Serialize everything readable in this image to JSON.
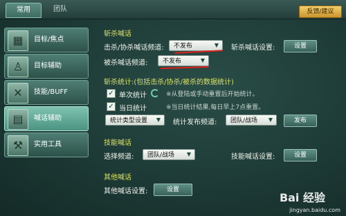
{
  "tabs": [
    {
      "label": "常用"
    },
    {
      "label": "团队"
    }
  ],
  "feedback_label": "反馈/建议",
  "sidebar": {
    "items": [
      {
        "label": "目标/焦点"
      },
      {
        "label": "目标辅助"
      },
      {
        "label": "技能/BUFF"
      },
      {
        "label": "喊话辅助"
      },
      {
        "label": "实用工具"
      }
    ]
  },
  "kill_shout": {
    "title": "斩杀喊话",
    "kill_channel_label": "击杀/协杀喊话频道:",
    "kill_channel_value": "不发布",
    "kill_settings_label": "斩杀喊话设置:",
    "killed_channel_label": "被杀喊话频道:",
    "killed_channel_value": "不发布",
    "settings_button": "设置"
  },
  "kill_stats": {
    "title": "斩杀统计:(包括击杀/协杀/被杀的数据统计)",
    "single_label": "单次统计",
    "single_note": "※从登陆或手动重置后开始统计。",
    "daily_label": "当日统计",
    "daily_note": "※当日统计结果,每日早上7点重置。",
    "type_select": "统计类型设置",
    "publish_channel_label": "统计发布频道:",
    "publish_channel_value": "团队/战场",
    "publish_button": "发布"
  },
  "skill_shout": {
    "title": "技能喊话",
    "channel_label": "选择频道:",
    "channel_value": "团队/战场",
    "settings_label": "技能喊话设置:",
    "settings_button": "设置"
  },
  "other_shout": {
    "title": "其他喊话",
    "settings_label": "其他喊话设置:",
    "settings_button": "设置"
  },
  "watermark": {
    "logo": "Bai 经验",
    "url": "jingyan.baidu.com"
  }
}
